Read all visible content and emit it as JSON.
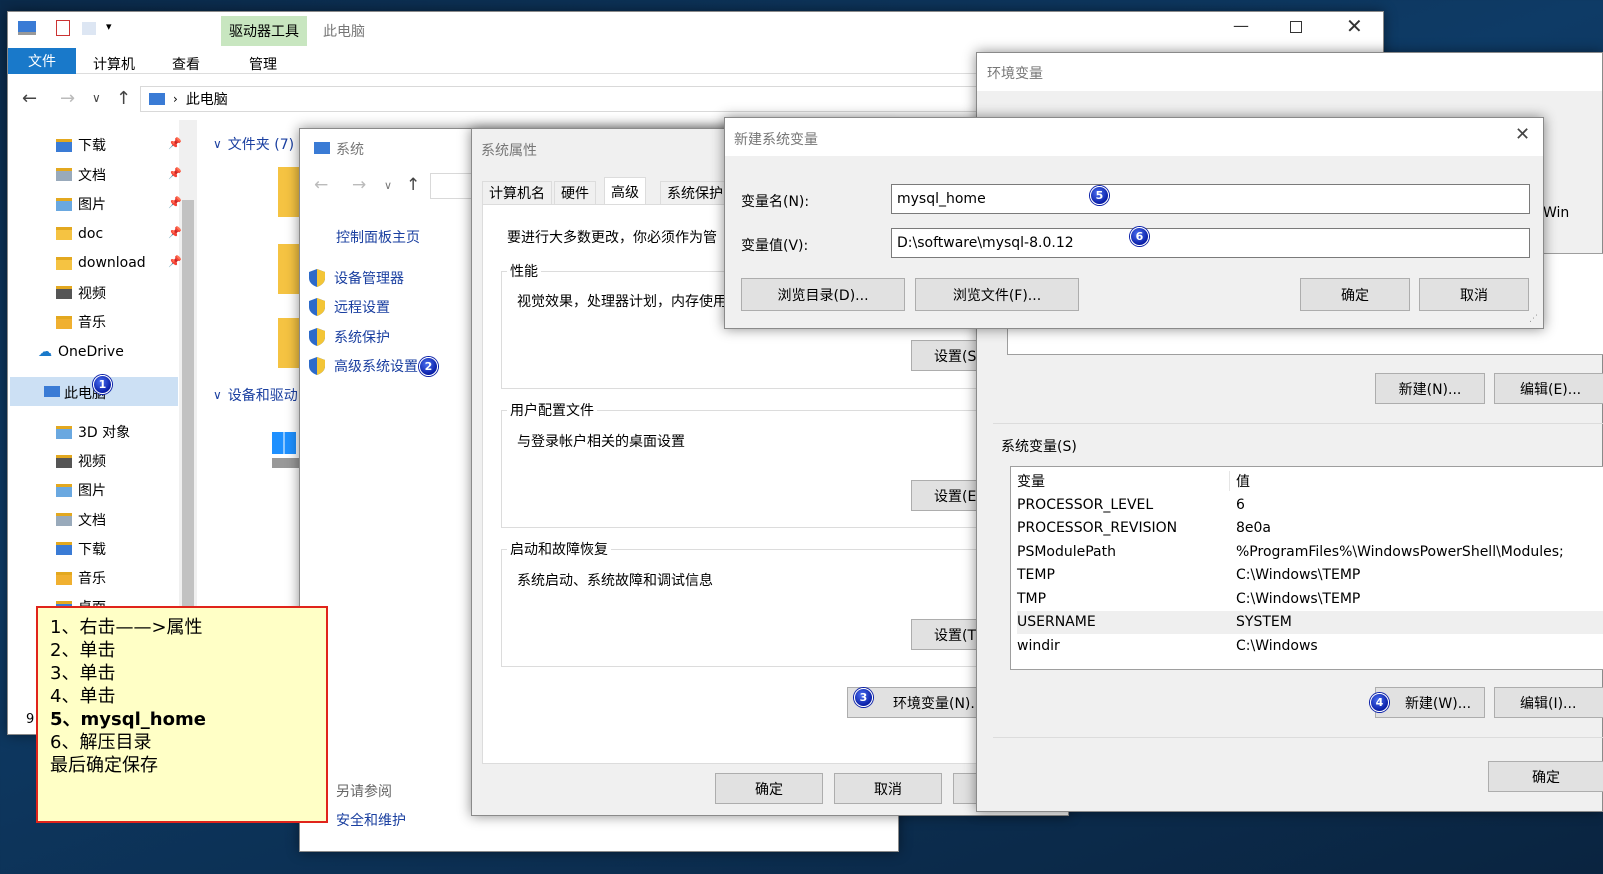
{
  "explorer": {
    "title": "此电脑",
    "ribbon_context_tab": "驱动器工具",
    "tabs": [
      "文件",
      "计算机",
      "查看",
      "管理"
    ],
    "address": "此电脑",
    "quick_access": [
      {
        "label": "下载",
        "pinned": true
      },
      {
        "label": "文档",
        "pinned": true
      },
      {
        "label": "图片",
        "pinned": true
      },
      {
        "label": "doc",
        "pinned": true
      },
      {
        "label": "download",
        "pinned": true
      },
      {
        "label": "视频",
        "pinned": false
      },
      {
        "label": "音乐",
        "pinned": false
      }
    ],
    "onedrive": "OneDrive",
    "this_pc": "此电脑",
    "this_pc_children": [
      "3D 对象",
      "视频",
      "图片",
      "文档",
      "下载",
      "音乐",
      "桌面"
    ],
    "section_folders": "文件夹 (7)",
    "section_devices": "设备和驱动",
    "status_count": "9"
  },
  "system": {
    "title": "系统",
    "home_link": "控制面板主页",
    "links": [
      "设备管理器",
      "远程设置",
      "系统保护",
      "高级系统设置"
    ],
    "see_also": "另请参阅",
    "see_also_link": "安全和维护"
  },
  "sysprops": {
    "title": "系统属性",
    "tabs": [
      "计算机名",
      "硬件",
      "高级",
      "系统保护"
    ],
    "intro": "要进行大多数更改，你必须作为管",
    "perf_label": "性能",
    "perf_text": "视觉效果，处理器计划，内存使用",
    "perf_button": "设置(S)",
    "profile_label": "用户配置文件",
    "profile_text": "与登录帐户相关的桌面设置",
    "profile_button": "设置(E)",
    "startup_label": "启动和故障恢复",
    "startup_text": "系统启动、系统故障和调试信息",
    "startup_button": "设置(T)",
    "env_button": "环境变量(N)...",
    "ok": "确定",
    "cancel": "取消"
  },
  "envvars": {
    "title": "环境变量",
    "user_new": "新建(N)...",
    "user_edit": "编辑(E)...",
    "clip_text": "Win",
    "sys_label": "系统变量(S)",
    "columns": [
      "变量",
      "值"
    ],
    "rows": [
      {
        "name": "PROCESSOR_LEVEL",
        "value": "6"
      },
      {
        "name": "PROCESSOR_REVISION",
        "value": "8e0a"
      },
      {
        "name": "PSModulePath",
        "value": "%ProgramFiles%\\WindowsPowerShell\\Modules;"
      },
      {
        "name": "TEMP",
        "value": "C:\\Windows\\TEMP"
      },
      {
        "name": "TMP",
        "value": "C:\\Windows\\TEMP"
      },
      {
        "name": "USERNAME",
        "value": "SYSTEM"
      },
      {
        "name": "windir",
        "value": "C:\\Windows"
      }
    ],
    "sys_new": "新建(W)...",
    "sys_edit": "编辑(I)...",
    "ok": "确定"
  },
  "newvar": {
    "title": "新建系统变量",
    "name_label": "变量名(N):",
    "name_value": "mysql_home",
    "value_label": "变量值(V):",
    "value_value": "D:\\software\\mysql-8.0.12",
    "browse_dir": "浏览目录(D)...",
    "browse_file": "浏览文件(F)...",
    "ok": "确定",
    "cancel": "取消"
  },
  "badges": [
    "1",
    "2",
    "3",
    "4",
    "5",
    "6"
  ],
  "note": {
    "lines": [
      "1、右击——>属性",
      "2、单击",
      "3、单击",
      "4、单击",
      "5、mysql_home",
      "6、解压目录",
      "最后确定保存"
    ]
  },
  "colors": {
    "accent": "#1979ca",
    "ribbon_context": "#c8e6c0",
    "note_bg": "#ffffc6",
    "note_border": "#e0241b",
    "badge": "#0a1fa8",
    "link": "#1a3fa0"
  }
}
